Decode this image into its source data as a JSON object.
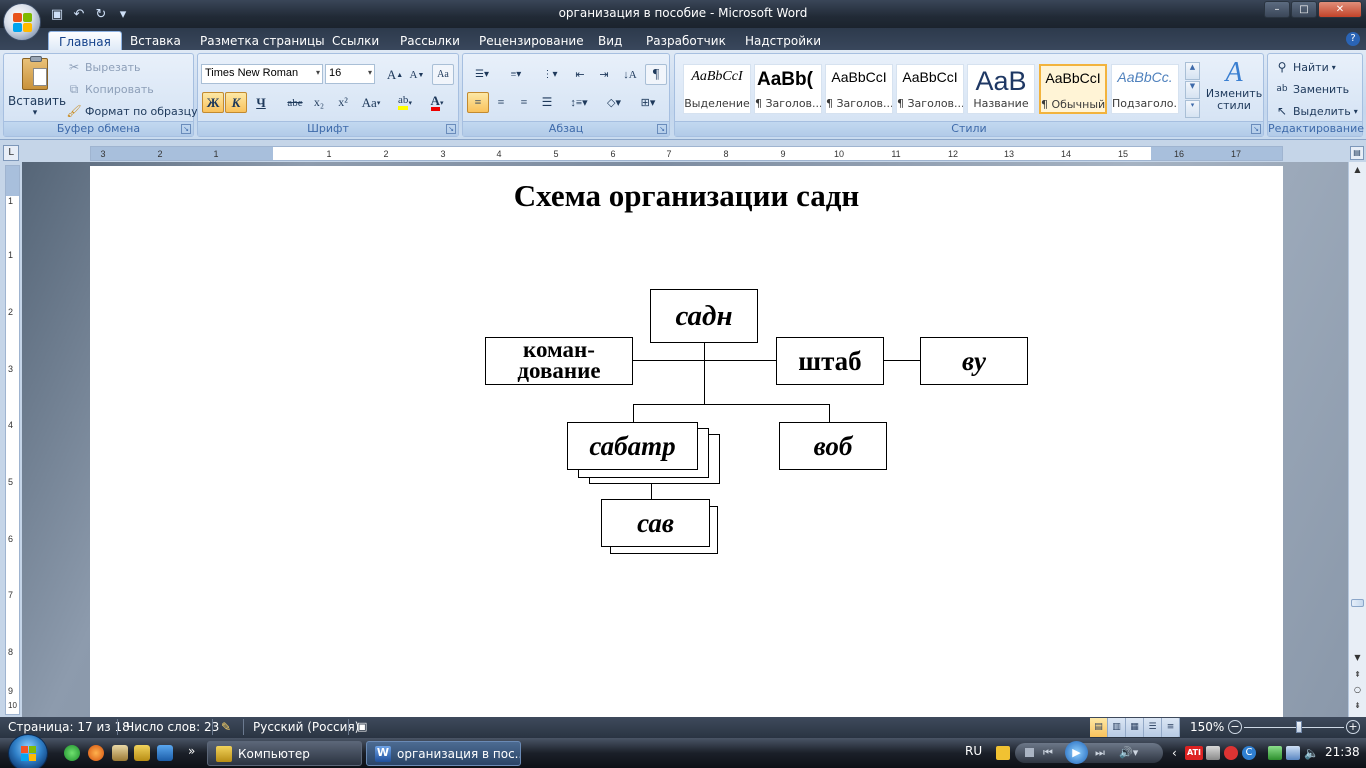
{
  "window": {
    "title": "организация  в пособие - Microsoft Word",
    "controls": {
      "minimize": "–",
      "maximize": "□",
      "close": "✕"
    }
  },
  "quick_access": {
    "save_icon": "save-icon",
    "undo_icon": "undo-icon",
    "redo_icon": "redo-icon",
    "more": "▾"
  },
  "tabs": [
    "Главная",
    "Вставка",
    "Разметка страницы",
    "Ссылки",
    "Рассылки",
    "Рецензирование",
    "Вид",
    "Разработчик",
    "Надстройки"
  ],
  "active_tab": "Главная",
  "help": "?",
  "ribbon": {
    "clipboard": {
      "label": "Буфер обмена",
      "paste": "Вставить",
      "paste_arrow": "▾",
      "cut": "Вырезать",
      "copy": "Копировать",
      "format_painter": "Формат по образцу"
    },
    "font": {
      "label": "Шрифт",
      "font_name": "Times New Roman",
      "font_size": "16",
      "grow": "A",
      "shrink": "A",
      "clear": "Aa",
      "bold": "Ж",
      "italic": "К",
      "underline": "Ч",
      "strikethrough": "abe",
      "subscript": "x₂",
      "superscript": "x²",
      "change_case": "Aa",
      "highlight": "ab",
      "font_color": "A"
    },
    "paragraph": {
      "label": "Абзац"
    },
    "styles": {
      "label": "Стили",
      "items": [
        {
          "sample": "AaBbCcI",
          "name": "Выделение"
        },
        {
          "sample": "AaBb(",
          "name": "¶ Заголов..."
        },
        {
          "sample": "AaBbCcI",
          "name": "¶ Заголов..."
        },
        {
          "sample": "AaBbCcI",
          "name": "¶ Заголов..."
        },
        {
          "sample": "AaB",
          "name": "Название"
        },
        {
          "sample": "AaBbCcI",
          "name": "¶ Обычный"
        },
        {
          "sample": "AaBbCc.",
          "name": "Подзаголо..."
        }
      ],
      "selected_index": 5,
      "change_styles": "Изменить стили"
    },
    "editing": {
      "label": "Редактирование",
      "find": "Найти",
      "replace": "Заменить",
      "select": "Выделить"
    }
  },
  "ruler": {
    "corner": "L",
    "h_labels": [
      "3",
      "2",
      "1",
      "1",
      "2",
      "3",
      "4",
      "5",
      "6",
      "7",
      "8",
      "9",
      "10",
      "11",
      "12",
      "13",
      "14",
      "15",
      "16",
      "17"
    ],
    "v_labels": [
      "1",
      "1",
      "2",
      "3",
      "4",
      "5",
      "6",
      "7",
      "8",
      "9",
      "10"
    ]
  },
  "document": {
    "title": "Схема организации садн",
    "org": {
      "top": "садн",
      "left": "коман-\nдование",
      "middle": "штаб",
      "right": "ву",
      "bottom_left": "сабатр",
      "bottom_right": "воб",
      "lowest": "сав"
    }
  },
  "statusbar": {
    "page": "Страница: 17 из 18",
    "words": "Число слов: 23",
    "language": "Русский (Россия)",
    "zoom": "150%",
    "zoom_level": 1.5,
    "view_icons": [
      "print-layout-icon",
      "full-screen-reading-icon",
      "web-layout-icon",
      "outline-icon",
      "draft-icon"
    ]
  },
  "taskbar": {
    "tasks": [
      {
        "label": "Компьютер"
      },
      {
        "label": "организация  в пос..."
      }
    ],
    "language": "RU",
    "clock": "21:38",
    "more": "»"
  }
}
